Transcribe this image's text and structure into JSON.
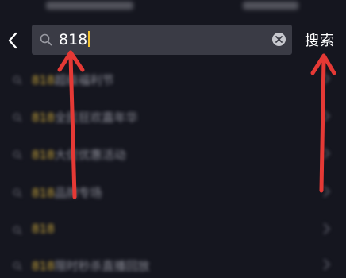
{
  "header": {
    "search": {
      "value": "818"
    },
    "search_button_label": "搜索"
  },
  "suggestions": [
    {
      "highlight": "818",
      "rest": "超级福利节"
    },
    {
      "highlight": "818",
      "rest": "全民狂欢嘉年华"
    },
    {
      "highlight": "818",
      "rest": "大促优惠活动"
    },
    {
      "highlight": "818",
      "rest": "品牌专场"
    },
    {
      "highlight": "818",
      "rest": ""
    },
    {
      "highlight": "818",
      "rest": "限时秒杀直播回放"
    }
  ],
  "colors": {
    "background": "#15161f",
    "search_box": "#3a3b45",
    "highlight": "#c9a63a",
    "annotation_arrow": "#e53935"
  },
  "icons": [
    "back-chevron-icon",
    "search-icon",
    "clear-icon",
    "arrow-icon"
  ]
}
